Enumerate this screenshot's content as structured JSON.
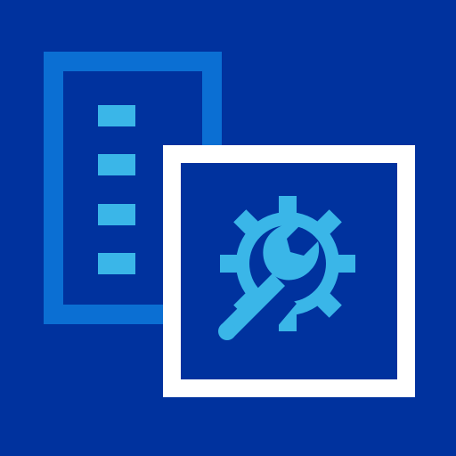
{
  "icon": {
    "semantic": "settings-app-icon",
    "components": [
      "document-list-icon",
      "settings-gear-wrench-icon"
    ]
  },
  "colors": {
    "background": "#00329e",
    "document_frame": "#0b6fd3",
    "list_bullets": "#3ab6e8",
    "settings_frame": "#ffffff",
    "gear_wrench": "#3ab6e8"
  }
}
